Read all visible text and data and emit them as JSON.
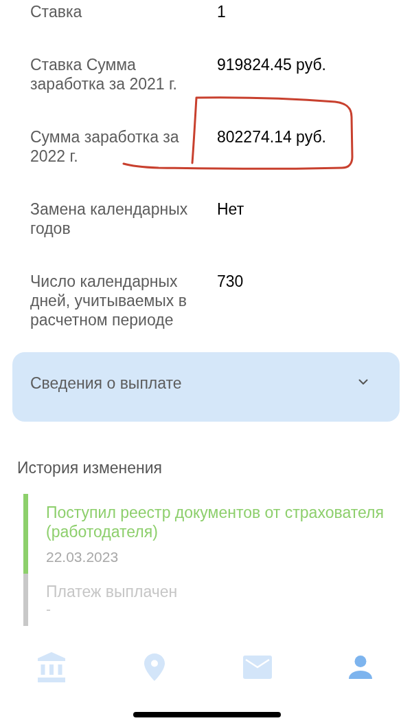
{
  "details": [
    {
      "label": "Ставка",
      "value": "1",
      "highlighted": false
    },
    {
      "label": "Ставка Сумма заработка за 2021 г.",
      "value": "919824.45 руб.",
      "highlighted": false
    },
    {
      "label": "Сумма заработка за 2022 г.",
      "value": "802274.14 руб.",
      "highlighted": true
    },
    {
      "label": "Замена календарных годов",
      "value": "Нет",
      "highlighted": false
    },
    {
      "label": "Число календарных дней, учитываемых в расчетном периоде",
      "value": "730",
      "highlighted": false
    }
  ],
  "payment_section": {
    "title": "Сведения о выплате",
    "expanded": false
  },
  "history": {
    "title": "История изменения",
    "events": [
      {
        "title": "Поступил реестр документов от страхователя (работодателя)",
        "date": "22.03.2023",
        "completed": true
      },
      {
        "title": "Платеж выплачен",
        "date": "-",
        "completed": false
      }
    ]
  },
  "tab_bar": [
    {
      "kind": "bank",
      "selected": false
    },
    {
      "kind": "location",
      "selected": false
    },
    {
      "kind": "mail",
      "selected": false
    },
    {
      "kind": "profile",
      "selected": true
    }
  ]
}
